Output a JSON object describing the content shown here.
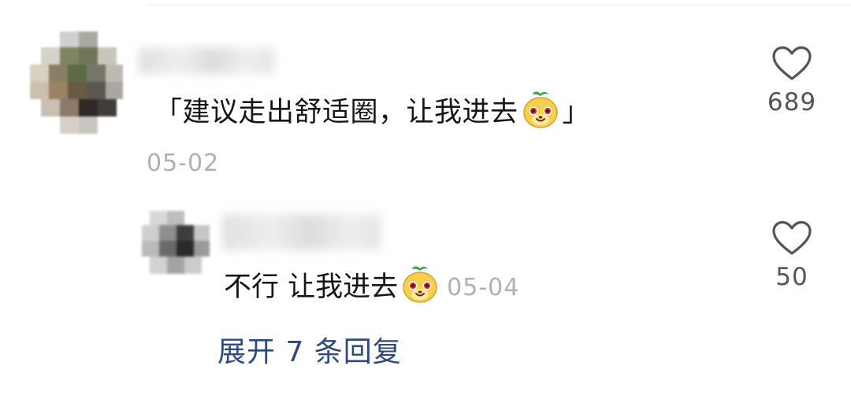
{
  "comment": {
    "text_before": "「建议走出舒适圈，让我进去",
    "text_after": "」",
    "emoji": "smiling-bean-emoji",
    "date": "05-02",
    "like_count": "689"
  },
  "reply": {
    "text": "不行 让我进去",
    "emoji": "smiling-bean-emoji",
    "date": "05-04",
    "like_count": "50"
  },
  "expand_replies": {
    "label": "展开 7 条回复"
  },
  "colors": {
    "text": "#161616",
    "muted": "#b0b0b0",
    "link": "#2c4a7a",
    "icon": "#555555"
  }
}
